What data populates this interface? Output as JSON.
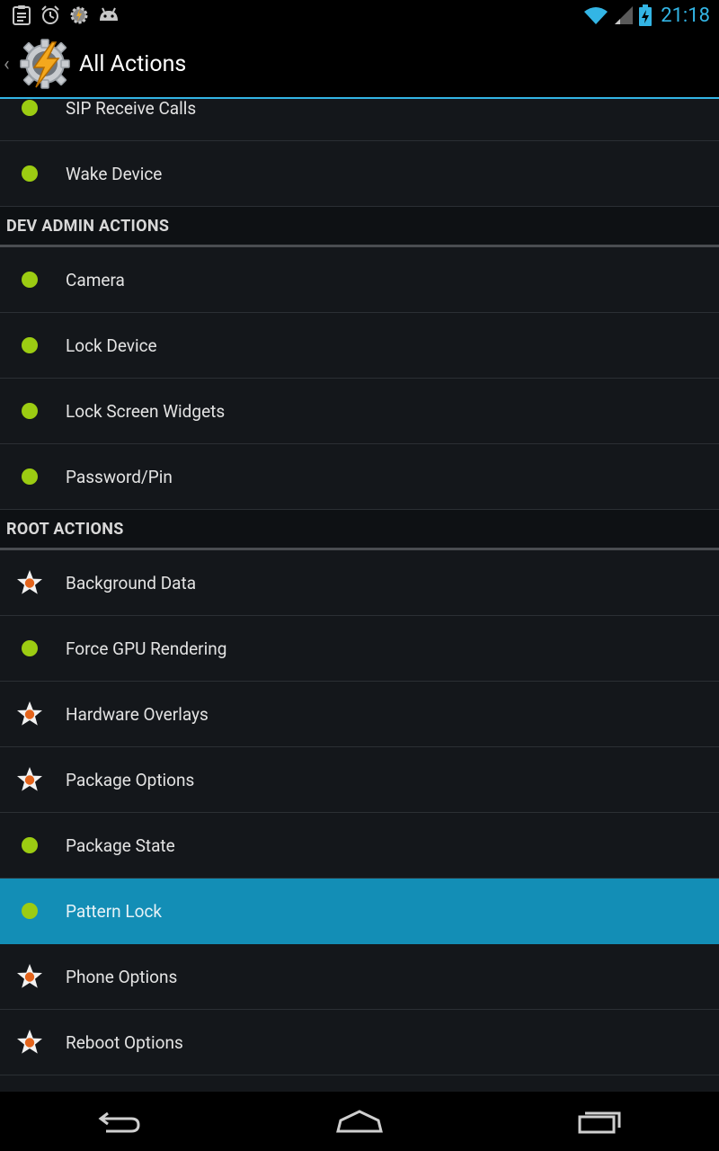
{
  "status_bar": {
    "time": "21:18",
    "left_icons": [
      "clipboard-icon",
      "alarm-icon",
      "tasker-gear-icon",
      "android-icon"
    ],
    "right_icons": [
      "wifi-icon",
      "signal-icon",
      "battery-charging-icon"
    ],
    "accent": "#33b5e5"
  },
  "action_bar": {
    "title": "All Actions"
  },
  "list": {
    "rows": [
      {
        "label": "SIP Receive Calls",
        "icon": "green-dot"
      },
      {
        "label": "Wake Device",
        "icon": "green-dot"
      },
      {
        "header": "DEV ADMIN ACTIONS"
      },
      {
        "label": "Camera",
        "icon": "green-dot"
      },
      {
        "label": "Lock Device",
        "icon": "green-dot"
      },
      {
        "label": "Lock Screen Widgets",
        "icon": "green-dot"
      },
      {
        "label": "Password/Pin",
        "icon": "green-dot"
      },
      {
        "header": "ROOT ACTIONS"
      },
      {
        "label": "Background Data",
        "icon": "star"
      },
      {
        "label": "Force GPU Rendering",
        "icon": "green-dot"
      },
      {
        "label": "Hardware Overlays",
        "icon": "star"
      },
      {
        "label": "Package Options",
        "icon": "star"
      },
      {
        "label": "Package State",
        "icon": "green-dot"
      },
      {
        "label": "Pattern Lock",
        "icon": "green-dot",
        "selected": true
      },
      {
        "label": "Phone Options",
        "icon": "star"
      },
      {
        "label": "Reboot Options",
        "icon": "star"
      }
    ]
  },
  "nav_bar": {
    "buttons": [
      "back-icon",
      "home-icon",
      "recent-apps-icon"
    ]
  }
}
